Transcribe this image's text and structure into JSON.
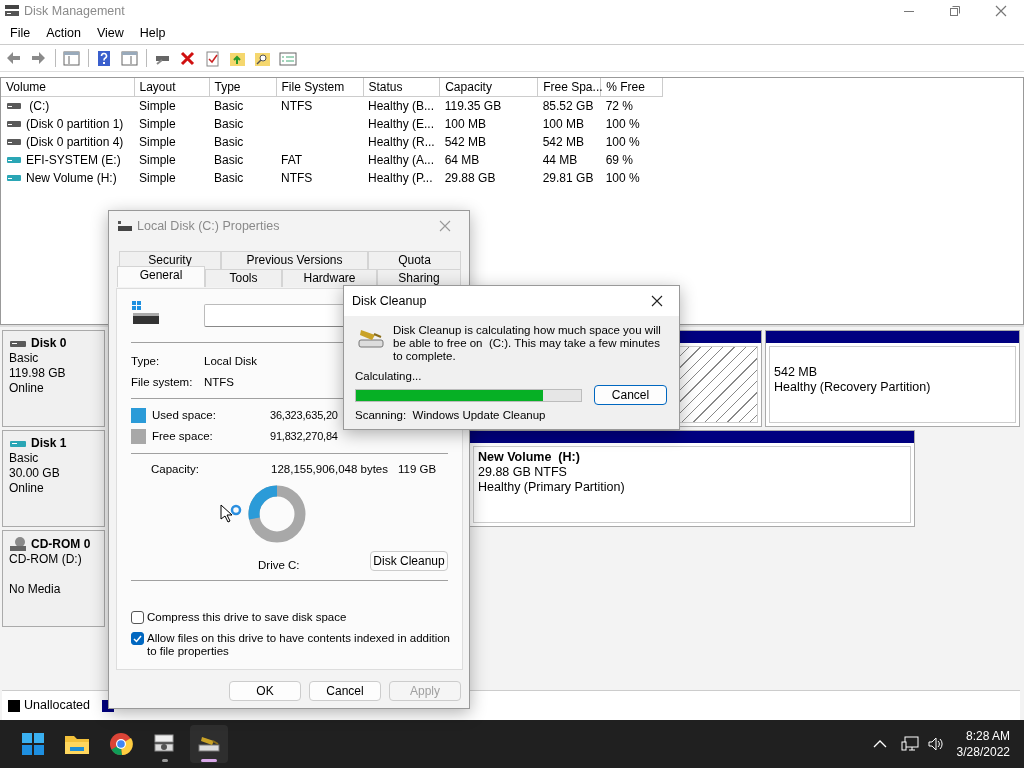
{
  "window": {
    "title": "Disk Management"
  },
  "menu": [
    "File",
    "Action",
    "View",
    "Help"
  ],
  "volumes": {
    "columns": [
      "Volume",
      "Layout",
      "Type",
      "File System",
      "Status",
      "Capacity",
      "Free Spa...",
      "% Free"
    ],
    "rows": [
      {
        "color": "#5a5a5a",
        "cells": [
          " (C:)",
          "Simple",
          "Basic",
          "NTFS",
          "Healthy (B...",
          "119.35 GB",
          "85.52 GB",
          "72 %"
        ]
      },
      {
        "color": "#5a5a5a",
        "cells": [
          "(Disk 0 partition 1)",
          "Simple",
          "Basic",
          "",
          "Healthy (E...",
          "100 MB",
          "100 MB",
          "100 %"
        ]
      },
      {
        "color": "#5a5a5a",
        "cells": [
          "(Disk 0 partition 4)",
          "Simple",
          "Basic",
          "",
          "Healthy (R...",
          "542 MB",
          "542 MB",
          "100 %"
        ]
      },
      {
        "color": "#2aa6b5",
        "cells": [
          "EFI-SYSTEM (E:)",
          "Simple",
          "Basic",
          "FAT",
          "Healthy (A...",
          "64 MB",
          "44 MB",
          "69 %"
        ]
      },
      {
        "color": "#2aa6b5",
        "cells": [
          "New Volume (H:)",
          "Simple",
          "Basic",
          "NTFS",
          "Healthy (P...",
          "29.88 GB",
          "29.81 GB",
          "100 %"
        ]
      }
    ]
  },
  "disks": [
    {
      "kind": "disk",
      "color": "#5a5a5a",
      "name": "Disk 0",
      "type": "Basic",
      "size": "119.98 GB",
      "status": "Online",
      "partitions": [
        {
          "kind": "hatched"
        },
        {
          "kind": "primary",
          "lines": [
            "542 MB",
            "Healthy (Recovery Partition)"
          ]
        }
      ]
    },
    {
      "kind": "disk",
      "color": "#2aa6b5",
      "name": "Disk 1",
      "type": "Basic",
      "size": "30.00 GB",
      "status": "Online",
      "partitions": [
        {
          "kind": "hidden"
        },
        {
          "kind": "primary",
          "title": "New Volume  (H:)",
          "lines": [
            "29.88 GB NTFS",
            "Healthy (Primary Partition)"
          ]
        }
      ]
    },
    {
      "kind": "cdrom",
      "color": "#8a8a8a",
      "name": "CD-ROM 0",
      "type": "CD-ROM (D:)",
      "status": "No Media"
    }
  ],
  "legend": [
    {
      "label": "Unallocated",
      "color": "#000000"
    },
    {
      "color": "#000080"
    }
  ],
  "properties": {
    "title": "Local Disk (C:) Properties",
    "tab_rows": [
      [
        {
          "label": "Security",
          "selected": false
        },
        {
          "label": "Previous Versions",
          "selected": false
        },
        {
          "label": "Quota",
          "selected": false
        }
      ],
      [
        {
          "label": "General",
          "selected": true
        },
        {
          "label": "Tools",
          "selected": false
        },
        {
          "label": "Hardware",
          "selected": false
        },
        {
          "label": "Sharing",
          "selected": false
        }
      ]
    ],
    "type_label": "Type:",
    "type_value": "Local Disk",
    "fs_label": "File system:",
    "fs_value": "NTFS",
    "space": [
      {
        "label": "Used space:",
        "bytes": "36,323,635,20",
        "color": "#2b9bd8"
      },
      {
        "label": "Free space:",
        "bytes": "91,832,270,84",
        "color": "#a8a8a8"
      }
    ],
    "capacity_label": "Capacity:",
    "capacity_bytes": "128,155,906,048 bytes",
    "capacity_size": "119 GB",
    "donut": {
      "level": 0.28
    },
    "drive_caption": "Drive C:",
    "cleanup_button": "Disk Cleanup",
    "options": [
      {
        "label": "Compress this drive to save disk space",
        "checked": false
      },
      {
        "label": "Allow files on this drive to have contents indexed in addition to file properties",
        "checked": true
      }
    ],
    "buttons": [
      {
        "label": "OK",
        "disabled": false
      },
      {
        "label": "Cancel",
        "disabled": false
      },
      {
        "label": "Apply",
        "disabled": true
      }
    ]
  },
  "cleanup": {
    "title": "Disk Cleanup",
    "message": "Disk Cleanup is calculating how much space you will be able to free on  (C:). This may take a few minutes to complete.",
    "status": "Calculating...",
    "progress": {
      "level": 0.83
    },
    "cancel": "Cancel",
    "scanning": "Scanning:  Windows Update Cleanup"
  },
  "taskbar": {
    "apps": [
      {
        "kind": "start",
        "running": false,
        "active": false
      },
      {
        "kind": "folder",
        "running": false,
        "active": false
      },
      {
        "kind": "browser",
        "running": false,
        "active": false
      },
      {
        "kind": "diskmgmt",
        "running": true,
        "active": false
      },
      {
        "kind": "cleanup",
        "running": true,
        "active": true
      }
    ],
    "time": "8:28 AM",
    "date": "3/28/2022"
  }
}
